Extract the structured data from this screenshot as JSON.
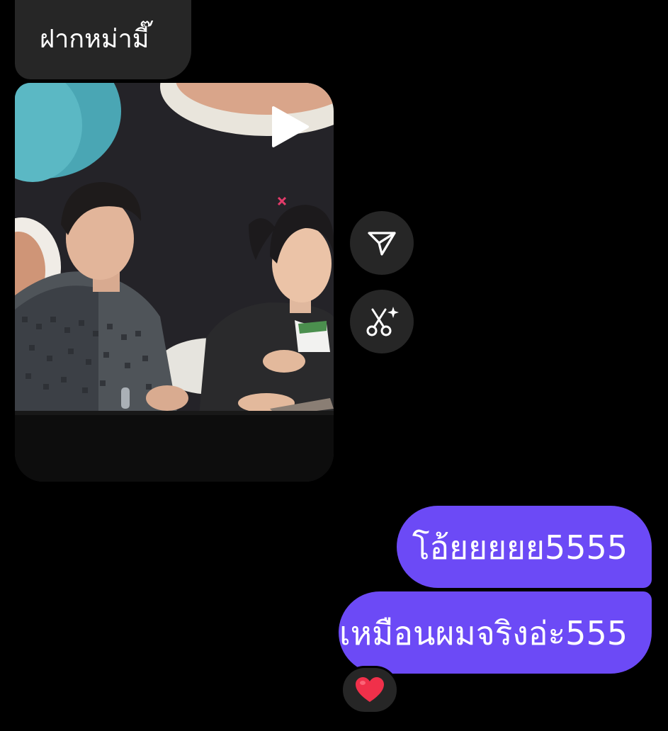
{
  "thread": {
    "incoming_message": "ฝากหม่ามี๊",
    "outgoing_messages": [
      "โอ้ยยยยย5555",
      "เหมือนผมจริงอ่ะ555"
    ],
    "reaction_emoji": "heart"
  },
  "icons": {
    "play": "play-icon",
    "share": "send-paper-plane-icon",
    "cutout": "scissors-sparkle-icon",
    "reaction": "red-heart-icon"
  },
  "colors": {
    "background": "#000000",
    "incoming_bubble": "#262626",
    "outgoing_bubble": "#6c4af6",
    "round_button": "#262626",
    "heart": "#f0304a"
  }
}
